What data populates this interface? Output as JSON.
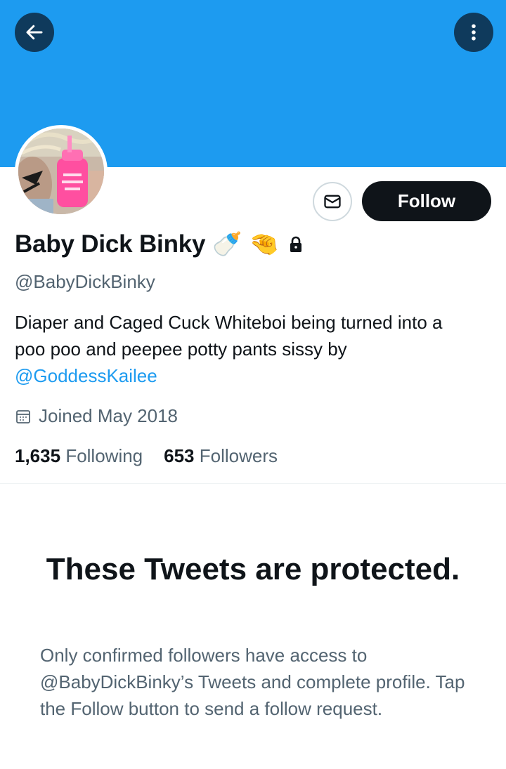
{
  "profile": {
    "display_name": "Baby Dick Binky",
    "name_emojis": [
      "🍼",
      "🤏"
    ],
    "handle": "@BabyDickBinky",
    "bio_text": "Diaper and Caged Cuck Whiteboi being turned into a poo poo and peepee potty pants sissy by",
    "bio_mention": "@GoddessKailee",
    "joined": "Joined May 2018",
    "following_count": "1,635",
    "following_label": "Following",
    "followers_count": "653",
    "followers_label": "Followers"
  },
  "actions": {
    "follow_label": "Follow"
  },
  "protected": {
    "title": "These Tweets are protected.",
    "body": "Only confirmed followers have access to @BabyDickBinky’s Tweets and complete profile. Tap the Follow button to send a follow request."
  },
  "icons": {
    "back": "arrow-left-icon",
    "more": "more-vertical-icon",
    "message": "envelope-icon",
    "lock": "lock-icon",
    "calendar": "calendar-icon"
  },
  "colors": {
    "banner": "#1d9bf0",
    "accent": "#1d9bf0",
    "follow_button": "#0f1419",
    "secondary_text": "#536471"
  }
}
